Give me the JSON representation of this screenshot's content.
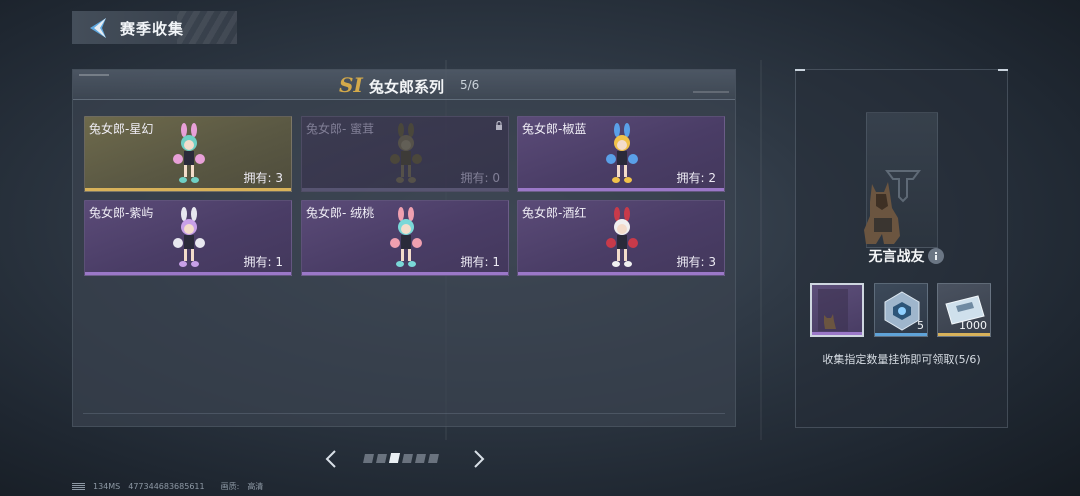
{
  "header": {
    "title": "赛季收集"
  },
  "panel": {
    "season_badge": "SI",
    "series_title": "兔女郎系列",
    "series_progress": "5/6"
  },
  "cards": [
    {
      "name": "兔女郎-星幻",
      "owned": "拥有: 3",
      "rarity": "gold",
      "locked": false,
      "hair": "#6fd0c4",
      "ears": "#e8a0d8"
    },
    {
      "name": "兔女郎- 蜜茸",
      "owned": "拥有: 0",
      "rarity": "locked",
      "locked": true,
      "hair": "#8a7a5a",
      "ears": "#7a6a4e"
    },
    {
      "name": "兔女郎-椒蓝",
      "owned": "拥有: 2",
      "rarity": "purple",
      "locked": false,
      "hair": "#f0c24a",
      "ears": "#5aa0e8"
    },
    {
      "name": "兔女郎-紫屿",
      "owned": "拥有: 1",
      "rarity": "purple",
      "locked": false,
      "hair": "#c8a0e8",
      "ears": "#e8e8f0"
    },
    {
      "name": "兔女郎- 绒桃",
      "owned": "拥有: 1",
      "rarity": "purple",
      "locked": false,
      "hair": "#7ad8d8",
      "ears": "#f0a0b0"
    },
    {
      "name": "兔女郎-酒红",
      "owned": "拥有: 3",
      "rarity": "purple",
      "locked": false,
      "hair": "#f0f0f0",
      "ears": "#c83a4a"
    }
  ],
  "pagination": {
    "pages": 6,
    "active_index": 2
  },
  "reward": {
    "name": "无言战友",
    "items": [
      {
        "label": "dog-pendant",
        "count": ""
      },
      {
        "label": "supply-crate",
        "count": "5"
      },
      {
        "label": "ticket",
        "count": "1000"
      }
    ],
    "description": "收集指定数量挂饰即可领取(5/6)"
  },
  "status": {
    "ping": "134MS",
    "uid": "477344683685611",
    "quality_label": "画质:",
    "quality_value": "高清"
  },
  "colors": {
    "gold": "#d8b25a",
    "purple": "#9b78c8",
    "blue": "#5fa3d8"
  }
}
